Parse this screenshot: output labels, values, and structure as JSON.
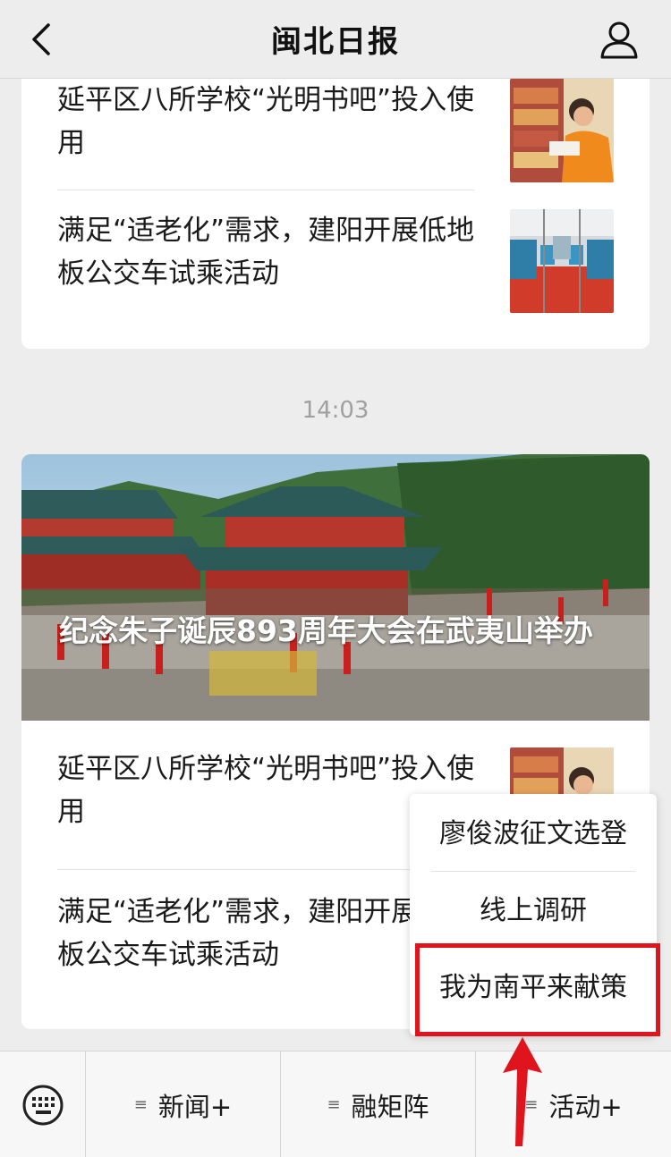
{
  "header": {
    "title": "闽北日报"
  },
  "top_card": {
    "items": [
      {
        "headline": "延平区八所学校“光明书吧”投入使用",
        "thumb": "reading-student"
      },
      {
        "headline": "满足“适老化”需求，建阳开展低地板公交车试乘活动",
        "thumb": "bus-interior"
      }
    ]
  },
  "timestamp": "14:03",
  "main_card": {
    "hero_caption": "纪念朱子诞辰893周年大会在武夷山举办",
    "items": [
      {
        "headline": "延平区八所学校“光明书吧”投入使用",
        "thumb": "reading-student"
      },
      {
        "headline": "满足“适老化”需求，建阳开展低地板公交车试乘活动",
        "thumb": "bus-interior"
      }
    ]
  },
  "bottom_menu": {
    "tabs": [
      {
        "label": "新闻+"
      },
      {
        "label": "融矩阵"
      },
      {
        "label": "活动+"
      }
    ]
  },
  "popup_menu": {
    "items": [
      {
        "label": "廖俊波征文选登"
      },
      {
        "label": "线上调研"
      },
      {
        "label": "我为南平来献策"
      }
    ]
  },
  "colors": {
    "accent_red": "#e0141c",
    "background": "#ededed"
  }
}
